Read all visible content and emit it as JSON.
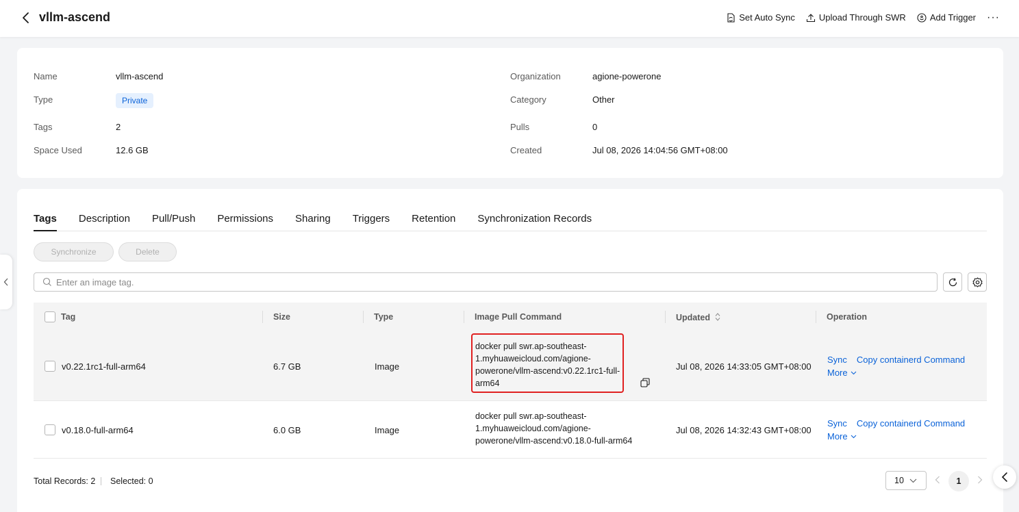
{
  "header": {
    "title": "vllm-ascend",
    "actions": [
      {
        "label": "Set Auto Sync",
        "icon": "sync-document-icon"
      },
      {
        "label": "Upload Through SWR",
        "icon": "upload-icon"
      },
      {
        "label": "Add Trigger",
        "icon": "trigger-icon"
      }
    ],
    "more": "···"
  },
  "info": {
    "name_label": "Name",
    "name_value": "vllm-ascend",
    "type_label": "Type",
    "type_value": "Private",
    "tags_label": "Tags",
    "tags_value": "2",
    "space_label": "Space Used",
    "space_value": "12.6 GB",
    "org_label": "Organization",
    "org_value": "agione-powerone",
    "category_label": "Category",
    "category_value": "Other",
    "pulls_label": "Pulls",
    "pulls_value": "0",
    "created_label": "Created",
    "created_value": "Jul 08, 2026 14:04:56 GMT+08:00"
  },
  "tabs": [
    "Tags",
    "Description",
    "Pull/Push",
    "Permissions",
    "Sharing",
    "Triggers",
    "Retention",
    "Synchronization Records"
  ],
  "toolbar": {
    "synchronize_label": "Synchronize",
    "delete_label": "Delete",
    "search_placeholder": "Enter an image tag."
  },
  "table": {
    "headers": {
      "tag": "Tag",
      "size": "Size",
      "type": "Type",
      "command": "Image Pull Command",
      "updated": "Updated",
      "operation": "Operation"
    },
    "rows": [
      {
        "tag": "v0.22.1rc1-full-arm64",
        "size": "6.7 GB",
        "type": "Image",
        "command_lines": [
          "docker pull swr.ap-southeast-",
          "1.myhuaweicloud.com/agione-",
          "powerone/vllm-ascend:v0.22.1rc1-full-",
          "arm64"
        ],
        "updated": "Jul 08, 2026 14:33:05 GMT+08:00",
        "op_sync": "Sync",
        "op_copy": "Copy containerd Command",
        "op_more": "More"
      },
      {
        "tag": "v0.18.0-full-arm64",
        "size": "6.0 GB",
        "type": "Image",
        "command_lines": [
          "docker pull swr.ap-southeast-",
          "1.myhuaweicloud.com/agione-",
          "powerone/vllm-ascend:v0.18.0-full-arm64"
        ],
        "updated": "Jul 08, 2026 14:32:43 GMT+08:00",
        "op_sync": "Sync",
        "op_copy": "Copy containerd Command",
        "op_more": "More"
      }
    ]
  },
  "footer": {
    "total": "Total Records: 2",
    "selected": "Selected: 0",
    "page_size": "10",
    "current_page": "1"
  },
  "colors": {
    "link": "#0a62d8",
    "highlight": "#e02020",
    "badge_bg": "#e5f0fe"
  }
}
